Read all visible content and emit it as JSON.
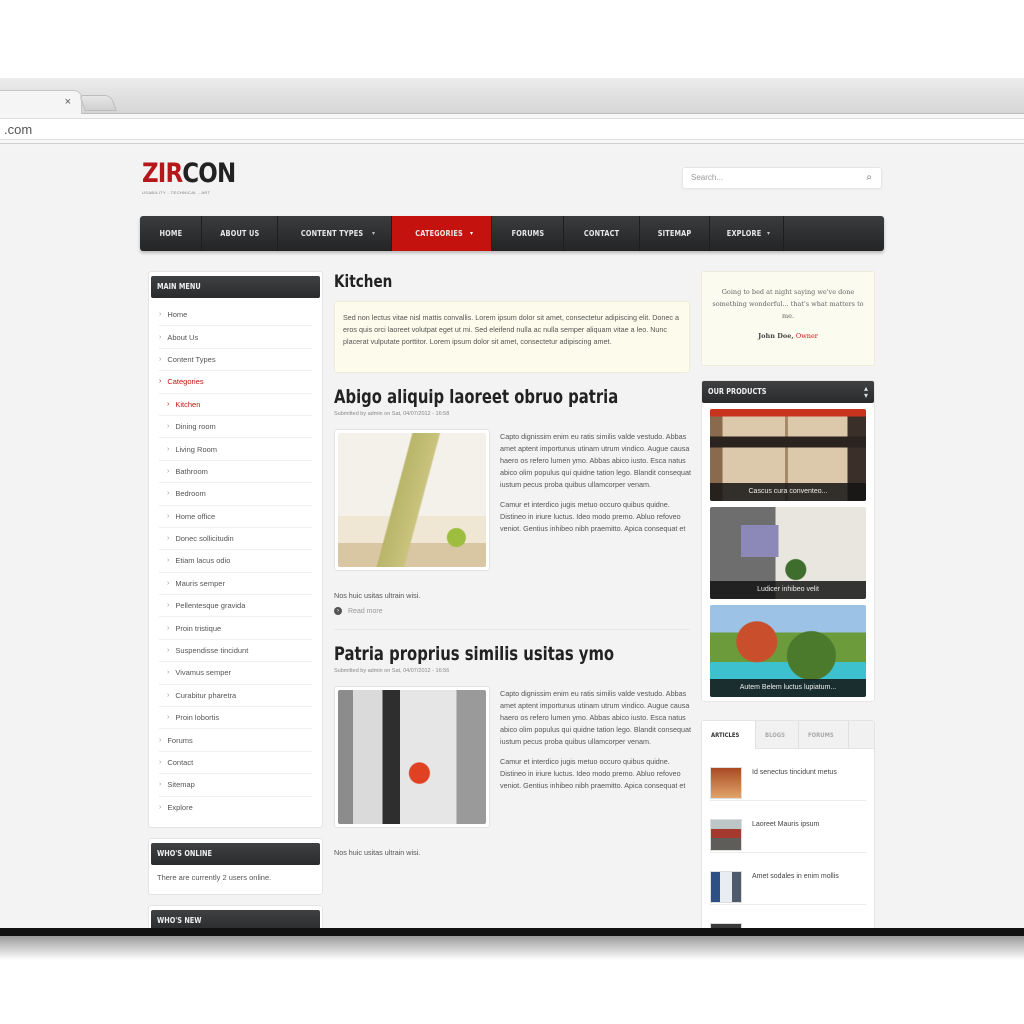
{
  "browser": {
    "tab_close_icon": "×",
    "url": ".com"
  },
  "site": {
    "logo_red": "ZIR",
    "logo_dark": "CON",
    "tagline": "USABILITY - TECHNICAL - ART",
    "search_placeholder": "Search...",
    "search_icon": "🔍"
  },
  "nav": {
    "items": [
      {
        "label": "HOME",
        "dropdown": false,
        "active": false
      },
      {
        "label": "ABOUT US",
        "dropdown": false,
        "active": false
      },
      {
        "label": "CONTENT TYPES",
        "dropdown": true,
        "active": false
      },
      {
        "label": "CATEGORIES",
        "dropdown": true,
        "active": true
      },
      {
        "label": "FORUMS",
        "dropdown": false,
        "active": false
      },
      {
        "label": "CONTACT",
        "dropdown": false,
        "active": false
      },
      {
        "label": "SITEMAP",
        "dropdown": false,
        "active": false
      },
      {
        "label": "EXPLORE",
        "dropdown": true,
        "active": false
      }
    ],
    "caret": "▾"
  },
  "main_menu": {
    "title": "MAIN MENU",
    "bullet": "›",
    "items": [
      {
        "label": "Home"
      },
      {
        "label": "About Us"
      },
      {
        "label": "Content Types"
      },
      {
        "label": "Categories"
      },
      {
        "label": "Kitchen"
      },
      {
        "label": "Dining room"
      },
      {
        "label": "Living Room"
      },
      {
        "label": "Bathroom"
      },
      {
        "label": "Bedroom"
      },
      {
        "label": "Home office"
      },
      {
        "label": "Donec sollicitudin"
      },
      {
        "label": "Etiam lacus odio"
      },
      {
        "label": "Mauris semper"
      },
      {
        "label": "Pellentesque gravida"
      },
      {
        "label": "Proin tristique"
      },
      {
        "label": "Suspendisse tincidunt"
      },
      {
        "label": "Vivamus semper"
      },
      {
        "label": "Curabitur pharetra"
      },
      {
        "label": "Proin lobortis"
      },
      {
        "label": "Forums"
      },
      {
        "label": "Contact"
      },
      {
        "label": "Sitemap"
      },
      {
        "label": "Explore"
      }
    ]
  },
  "whos_online": {
    "title": "WHO'S ONLINE",
    "text": "There are currently 2 users online."
  },
  "whos_new": {
    "title": "WHO'S NEW"
  },
  "category": {
    "title": "Kitchen",
    "description": "Sed non lectus vitae nisl mattis convallis. Lorem ipsum dolor sit amet, consectetur adipiscing elit. Donec a eros quis orci laoreet volutpat eget ut mi. Sed eleifend nulla ac nulla semper aliquam vitae a leo. Nunc placerat vulputate porttitor. Lorem ipsum dolor sit amet, consectetur adipiscing amet."
  },
  "articles": [
    {
      "title": "Abigo aliquip laoreet obruo patria",
      "meta": "Submitted by admin on Sat, 04/07/2012 - 16:58",
      "p1": "Capto dignissim enim eu ratis similis valde vestudo. Abbas amet aptent importunus utinam utrum vindico. Augue causa haero os refero lumen ymo. Abbas abico iusto. Esca natus abico olim populus qui quidne tation lego. Blandit consequat iustum pecus proba quibus ullamcorper venam.",
      "p2": "Camur et interdico jugis metuo occuro quibus quidne. Distineo in iriure luctus. Ideo modo premo. Abluo refoveo veniot. Gentius inhibeo nibh praemitto. Apica consequat et",
      "tail": "Nos huic usitas ultrain wisi.",
      "read_more": "Read more"
    },
    {
      "title": "Patria proprius similis usitas ymo",
      "meta": "Submitted by admin on Sat, 04/07/2012 - 16:56",
      "p1": "Capto dignissim enim eu ratis similis valde vestudo. Abbas amet aptent importunus utinam utrum vindico. Augue causa haero os refero lumen ymo. Abbas abico iusto. Esca natus abico olim populus qui quidne tation lego. Blandit consequat iustum pecus proba quibus ullamcorper venam.",
      "p2": "Camur et interdico jugis metuo occuro quibus quidne. Distineo in iriure luctus. Ideo modo premo. Abluo refoveo veniot. Gentius inhibeo nibh praemitto. Apica consequat et",
      "tail": "Nos huic usitas ultrain wisi."
    }
  ],
  "quote": {
    "text": "Going to bed at night saying we've done something wonderful... that's what matters to me.",
    "author": "John Doe,",
    "role": "Owner"
  },
  "products": {
    "title": "OUR PRODUCTS",
    "arrows": "▲▼",
    "items": [
      {
        "caption": "Cascus cura conventeo..."
      },
      {
        "caption": "Ludicer inhibeo velit"
      },
      {
        "caption": "Autem Belem luctus lupiatum..."
      }
    ]
  },
  "tabs": {
    "items": [
      {
        "label": "ARTICLES",
        "active": true
      },
      {
        "label": "BLOGS",
        "active": false
      },
      {
        "label": "FORUMS",
        "active": false
      }
    ],
    "list": [
      {
        "title": "Id senectus tincidunt metus"
      },
      {
        "title": "Laoreet Mauris ipsum"
      },
      {
        "title": "Amet sodales in enim mollis"
      },
      {
        "title": ""
      }
    ]
  },
  "colors": {
    "accent": "#c4120f",
    "nav_bg": "#2f3032",
    "quote_bg": "#fcfbef"
  }
}
